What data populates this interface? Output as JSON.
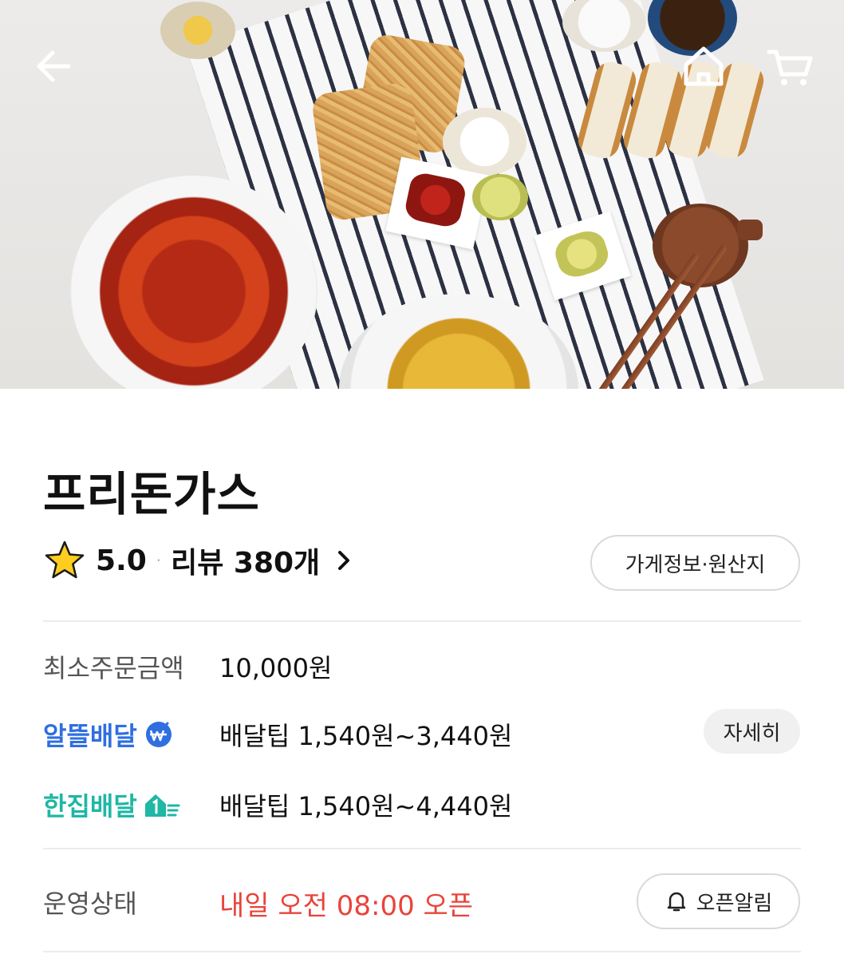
{
  "hero": {
    "back_icon": "arrow-left-icon",
    "home_icon": "home-icon",
    "cart_icon": "cart-icon"
  },
  "store": {
    "name": "프리돈가스",
    "rating": "5.0",
    "reviews_label": "리뷰 380개",
    "rating_separator": "·",
    "info_button": "가게정보·원산지"
  },
  "order": {
    "min_label": "최소주문금액",
    "min_value": "10,000원"
  },
  "delivery": {
    "saver": {
      "brand": "알뜰배달",
      "tip": "배달팁 1,540원~3,440원",
      "detail_button": "자세히",
      "color": "#2f6fe0"
    },
    "single": {
      "brand": "한집배달",
      "tip": "배달팁 1,540원~4,440원",
      "color": "#1fb7a5"
    }
  },
  "status": {
    "label": "운영상태",
    "value": "내일 오전 08:00 오픈",
    "value_color": "#e8443b",
    "notify_button": "오픈알림"
  }
}
